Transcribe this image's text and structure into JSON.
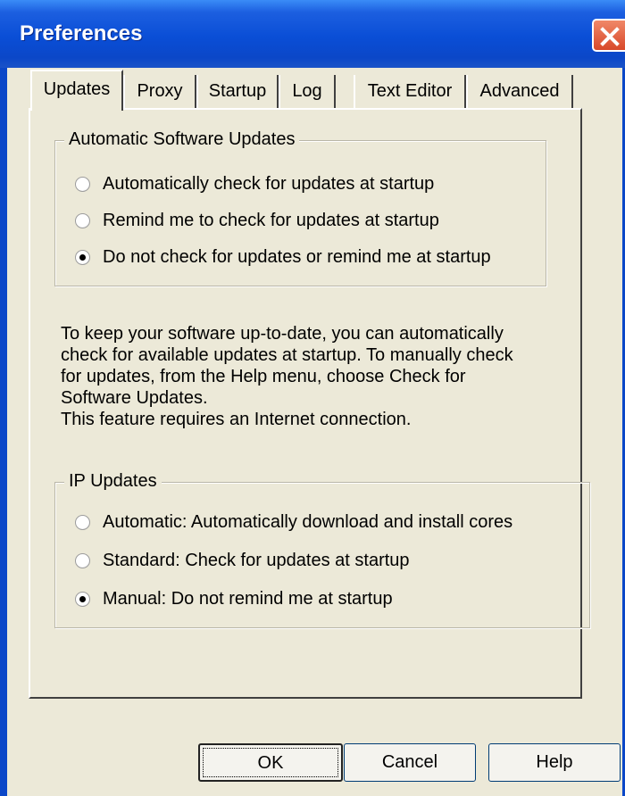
{
  "window": {
    "title": "Preferences"
  },
  "tabs": [
    {
      "label": "Updates"
    },
    {
      "label": "Proxy"
    },
    {
      "label": "Startup"
    },
    {
      "label": "Log"
    },
    {
      "label": "Text Editor"
    },
    {
      "label": "Advanced"
    }
  ],
  "auto_updates": {
    "legend": "Automatic Software Updates",
    "options": [
      {
        "label": "Automatically check for updates at startup",
        "checked": false
      },
      {
        "label": "Remind me to check for updates at startup",
        "checked": false
      },
      {
        "label": "Do not check for updates or remind me at startup",
        "checked": true
      }
    ]
  },
  "info": {
    "lines": [
      "To keep your software up-to-date, you can automatically",
      "check for available updates at startup.  To manually check",
      "for updates, from the Help menu, choose Check for",
      "Software Updates.",
      "This feature requires an Internet connection."
    ]
  },
  "ip_updates": {
    "legend": "IP Updates",
    "options": [
      {
        "label": "Automatic: Automatically download and install cores",
        "checked": false
      },
      {
        "label": "Standard: Check for updates at startup",
        "checked": false
      },
      {
        "label": "Manual: Do not remind me at startup",
        "checked": true
      }
    ]
  },
  "buttons": {
    "ok": "OK",
    "cancel": "Cancel",
    "help": "Help"
  }
}
